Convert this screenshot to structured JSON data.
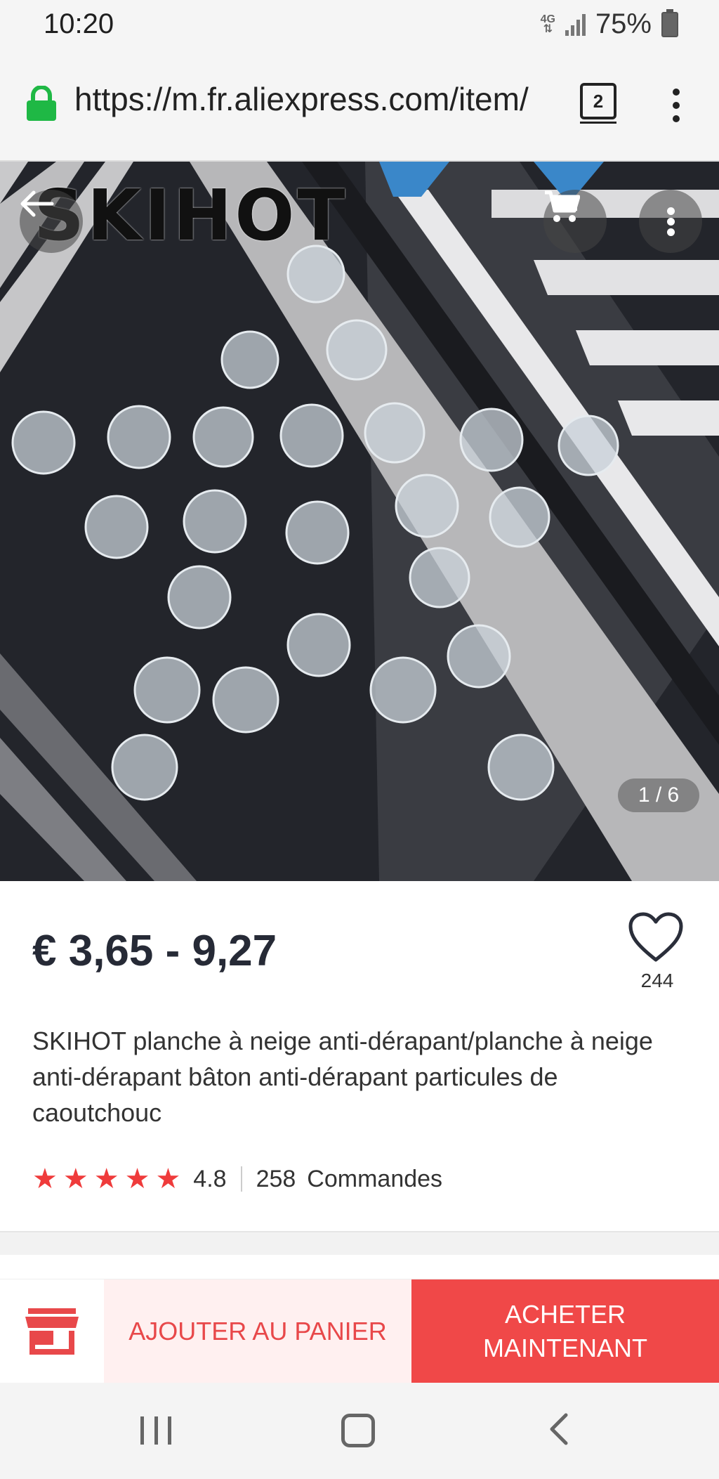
{
  "status_bar": {
    "time": "10:20",
    "network": "4G",
    "battery": "75%"
  },
  "browser": {
    "url": "https://m.fr.aliexpress.com/item/",
    "tab_count": "2"
  },
  "gallery": {
    "brand_logo": "SKIHOT",
    "counter": "1 / 6"
  },
  "product": {
    "price": "€ 3,65 - 9,27",
    "wishlist_count": "244",
    "title": "SKIHOT planche à neige anti-dérapant/planche à neige anti-dérapant bâton anti-dérapant particules de caoutchouc",
    "rating": "4.8",
    "stars": 5,
    "orders_count": "258",
    "orders_label": "Commandes"
  },
  "actions": {
    "add_to_cart": "AJOUTER AU PANIER",
    "buy_now_line1": "ACHETER",
    "buy_now_line2": "MAINTENANT"
  },
  "icons": [
    "lock-icon",
    "tabs-icon",
    "menu-icon",
    "back-arrow-icon",
    "cart-icon",
    "more-icon",
    "heart-icon",
    "star-icon",
    "store-icon",
    "recent-apps-icon",
    "home-icon",
    "nav-back-icon"
  ],
  "colors": {
    "accent": "#f04848",
    "accent_light": "#fff0f0",
    "lock_green": "#1fb845",
    "star": "#ef3b3b"
  }
}
